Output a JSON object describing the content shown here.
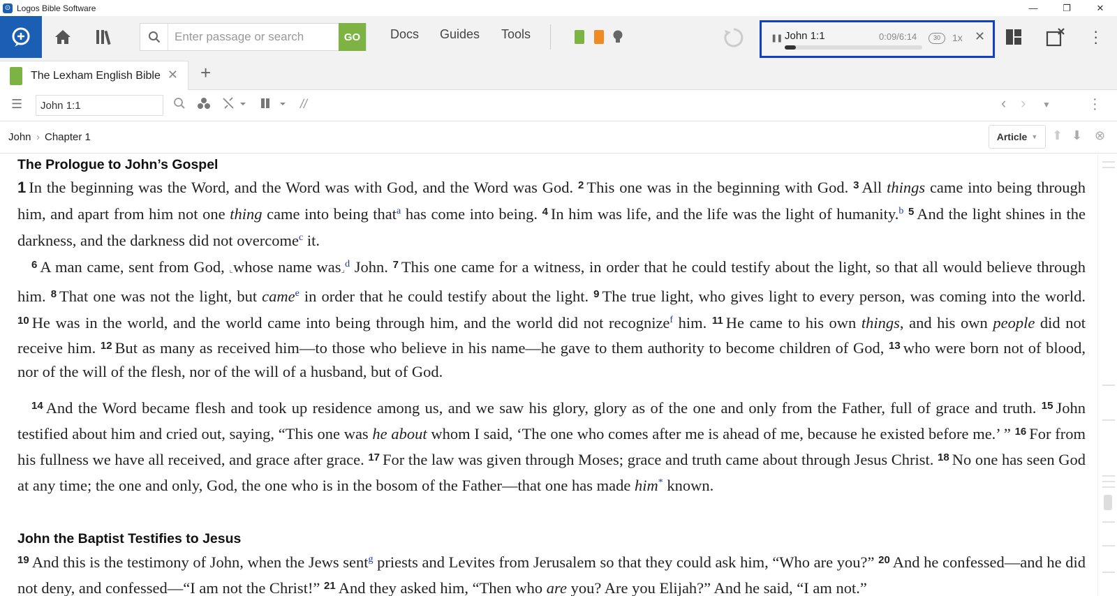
{
  "window": {
    "title": "Logos Bible Software",
    "controls": [
      "minimize",
      "restore",
      "close"
    ]
  },
  "toolbar": {
    "search_placeholder": "Enter passage or search",
    "go_label": "GO",
    "menu": [
      "Docs",
      "Guides",
      "Tools"
    ]
  },
  "player": {
    "reference": "John 1:1",
    "time": "0:09/6:14",
    "progress": 0.024,
    "skip_label": "30",
    "speed": "1x"
  },
  "tab": {
    "label": "The Lexham English Bible"
  },
  "resource": {
    "reference": "John 1:1"
  },
  "breadcrumb": {
    "book": "John",
    "separator": "›",
    "chapter": "Chapter 1",
    "view_mode": "Article"
  },
  "text": {
    "heading1": "The Prologue to John’s Gospel",
    "heading2": "John the Baptist Testifies to Jesus"
  }
}
